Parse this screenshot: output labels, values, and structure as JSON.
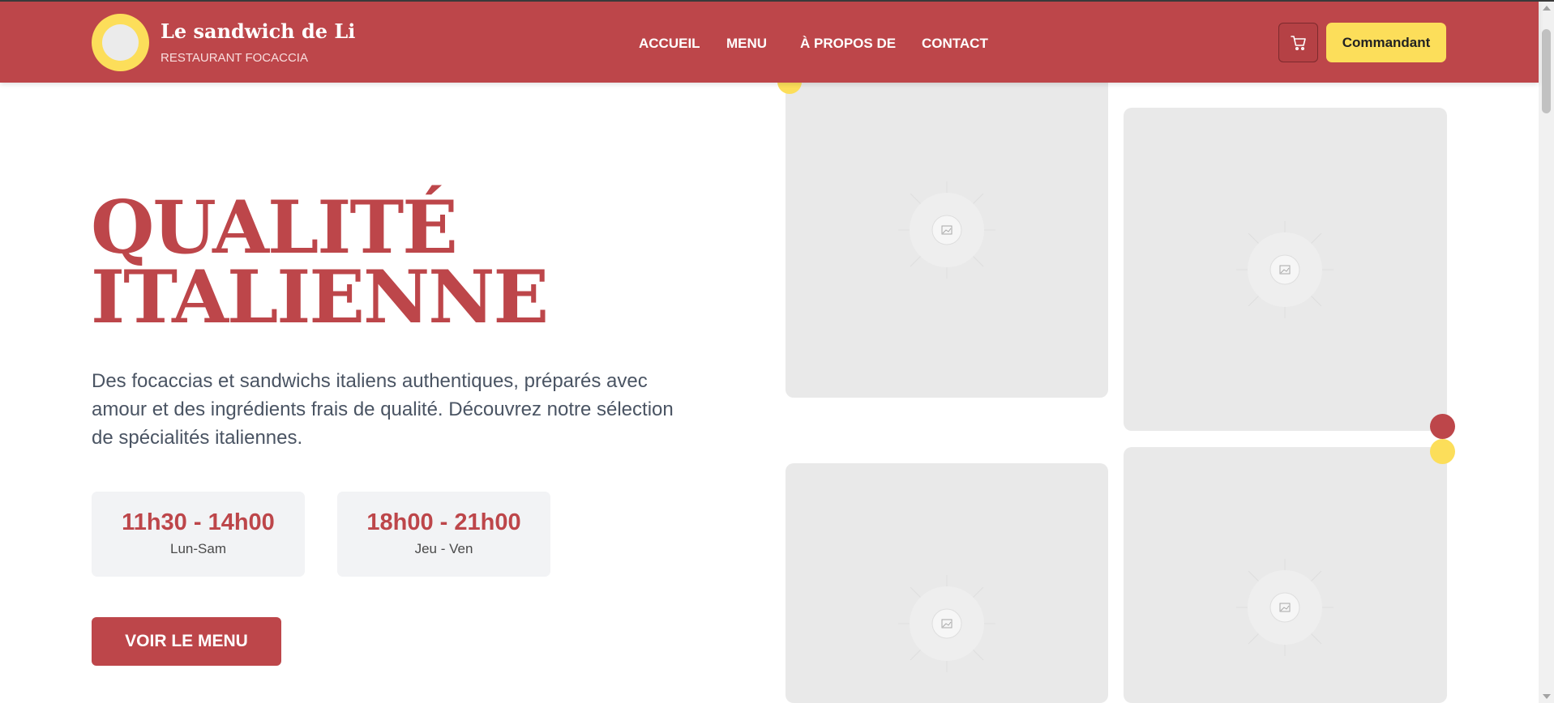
{
  "brand": {
    "name": "Le sandwich de Li",
    "subtitle": "RESTAURANT FOCACCIA"
  },
  "nav": {
    "items": [
      {
        "label": "ACCUEIL"
      },
      {
        "label": "MENU"
      },
      {
        "label": "À PROPOS DE"
      },
      {
        "label": "CONTACT"
      }
    ]
  },
  "header": {
    "cart_icon": "shopping-cart-icon",
    "order_label": "Commandant"
  },
  "hero": {
    "title_line1": "QUALITÉ",
    "title_line2": "ITALIENNE",
    "description": "Des focaccias et sandwichs italiens authentiques, préparés avec amour et des ingrédients frais de qualité. Découvrez notre sélection de spécialités italiennes.",
    "hours": [
      {
        "time": "11h30 - 14h00",
        "days": "Lun-Sam"
      },
      {
        "time": "18h00 - 21h00",
        "days": "Jeu - Ven"
      }
    ],
    "menu_button": "VOIR LE MENU"
  },
  "gallery": {
    "placeholder_icon": "image-placeholder-icon"
  },
  "colors": {
    "primary": "#bd464a",
    "accent": "#fcde5a",
    "placeholder": "#e9e9e9",
    "hours_bg": "#f2f3f5",
    "text_muted": "#4a5463"
  }
}
